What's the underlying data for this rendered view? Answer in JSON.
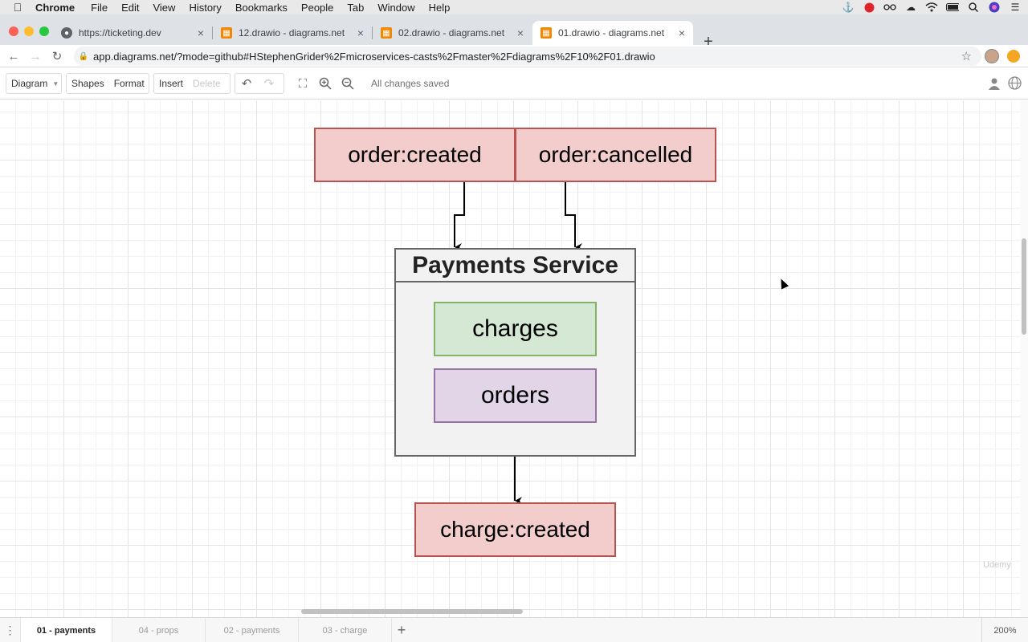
{
  "menubar": {
    "app": "Chrome",
    "items": [
      "File",
      "Edit",
      "View",
      "History",
      "Bookmarks",
      "People",
      "Tab",
      "Window",
      "Help"
    ],
    "status_icons": [
      "docker-icon",
      "record-icon",
      "glasses-icon",
      "cloud-icon",
      "wifi-icon",
      "battery-icon",
      "search-icon",
      "siri-icon",
      "notification-list-icon"
    ]
  },
  "tabs": [
    {
      "title": "https://ticketing.dev",
      "icon": "globe-icon",
      "active": false
    },
    {
      "title": "12.drawio - diagrams.net",
      "icon": "drawio-icon",
      "active": false
    },
    {
      "title": "02.drawio - diagrams.net",
      "icon": "drawio-icon",
      "active": false
    },
    {
      "title": "01.drawio - diagrams.net",
      "icon": "drawio-icon",
      "active": true
    }
  ],
  "address": {
    "url": "app.diagrams.net/?mode=github#HStephenGrider%2Fmicroservices-casts%2Fmaster%2Fdiagrams%2F10%2F01.drawio"
  },
  "toolbar": {
    "diagram": "Diagram",
    "shapes": "Shapes",
    "format": "Format",
    "insert": "Insert",
    "delete": "Delete",
    "status": "All changes saved"
  },
  "diagram": {
    "event_order_created": "order:created",
    "event_order_cancelled": "order:cancelled",
    "service_title": "Payments Service",
    "collection_charges": "charges",
    "collection_orders": "orders",
    "event_charge_created": "charge:created",
    "colors": {
      "event_fill": "#f2cdcc",
      "event_stroke": "#b85450",
      "charges_fill": "#d5e8d4",
      "charges_stroke": "#82b366",
      "orders_fill": "#e1d5e7",
      "orders_stroke": "#9673a6",
      "service_fill": "#f2f2f2",
      "service_stroke": "#666666"
    }
  },
  "watermark": "Udemy",
  "pages": [
    "01 - payments",
    "04 - props",
    "02 - payments",
    "03 - charge"
  ],
  "active_page": "01 - payments",
  "zoom": "200%"
}
